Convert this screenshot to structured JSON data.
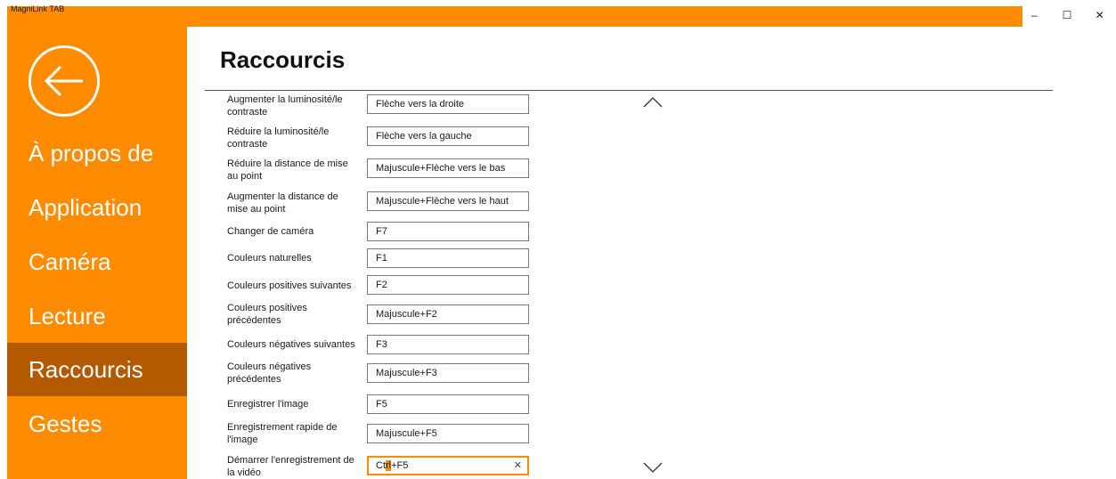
{
  "window": {
    "title": "MagniLink TAB",
    "controls": [
      "–",
      "☐",
      "✕"
    ]
  },
  "sidebar": {
    "back_icon": "back-arrow-icon",
    "items": [
      {
        "label": "À propos de",
        "active": false
      },
      {
        "label": "Application",
        "active": false
      },
      {
        "label": "Caméra",
        "active": false
      },
      {
        "label": "Lecture",
        "active": false
      },
      {
        "label": "Raccourcis",
        "active": true
      },
      {
        "label": "Gestes",
        "active": false
      }
    ]
  },
  "main": {
    "title": "Raccourcis",
    "shortcuts": [
      {
        "label": "Augmenter la luminosité/le contraste",
        "value": "Flèche vers la droite"
      },
      {
        "label": "Réduire la luminosité/le contraste",
        "value": "Flèche vers la gauche"
      },
      {
        "label": "Réduire la distance de mise au point",
        "value": "Majuscule+Flèche vers le bas"
      },
      {
        "label": "Augmenter la distance de mise au point",
        "value": "Majuscule+Flèche vers le haut"
      },
      {
        "label": "Changer de caméra",
        "value": "F7"
      },
      {
        "label": "Couleurs naturelles",
        "value": "F1"
      },
      {
        "label": "Couleurs positives suivantes",
        "value": "F2"
      },
      {
        "label": "Couleurs positives précédentes",
        "value": "Majuscule+F2"
      },
      {
        "label": "Couleurs négatives suivantes",
        "value": "F3"
      },
      {
        "label": "Couleurs négatives précédentes",
        "value": "Majuscule+F3"
      },
      {
        "label": "Enregistrer l'image",
        "value": "F5"
      },
      {
        "label": "Enregistrement rapide de l'image",
        "value": "Majuscule+F5"
      },
      {
        "label": "Démarrer l'enregistrement de la vidéo",
        "value": "Ctrl+F5",
        "focused": true,
        "clear_icon": "✕"
      }
    ],
    "scroll_up_icon": "chevron-up-icon",
    "scroll_down_icon": "chevron-down-icon"
  },
  "colors": {
    "accent": "#ff8c00",
    "active_nav": "#b35900",
    "background": "#ffffff"
  }
}
